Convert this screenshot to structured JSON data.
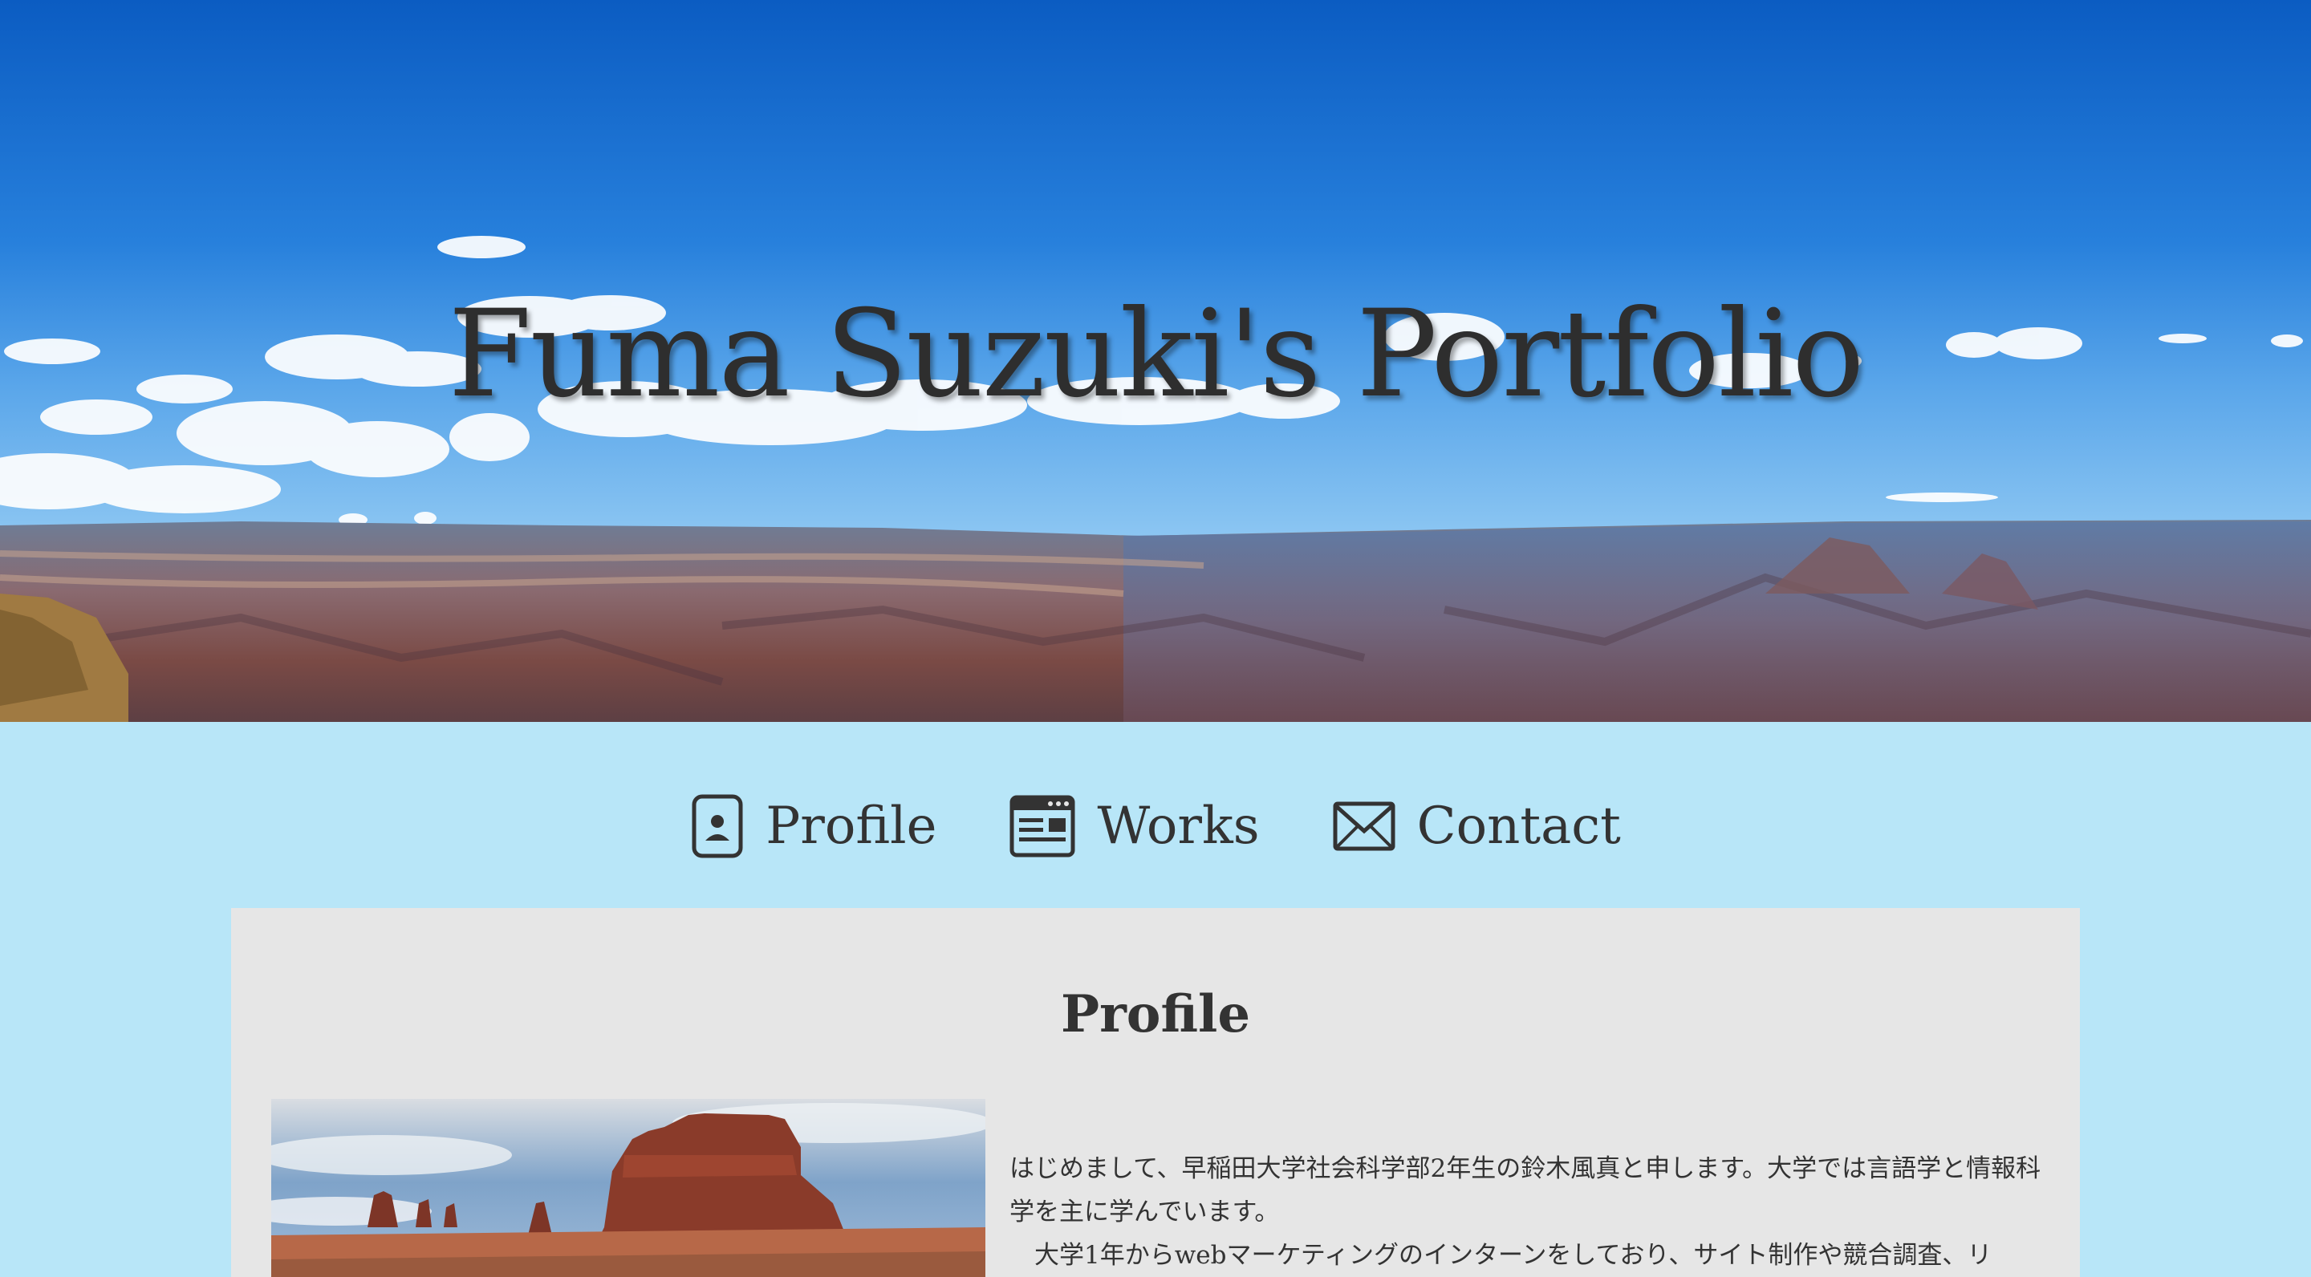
{
  "hero": {
    "title": "Fuma Suzuki's Portfolio"
  },
  "nav": {
    "items": [
      {
        "label": "Profile",
        "icon": "profile-card-icon"
      },
      {
        "label": "Works",
        "icon": "browser-window-icon"
      },
      {
        "label": "Contact",
        "icon": "envelope-icon"
      }
    ]
  },
  "profile": {
    "heading": "Profile",
    "paragraph1": "はじめまして、早稲田大学社会科学部2年生の鈴木風真と申します。大学では言語学と情報科学を主に学んでいます。",
    "paragraph2": "大学1年からwebマーケティングのインターンをしており、サイト制作や競合調査、リ"
  },
  "colors": {
    "page_background": "#b8e6f8",
    "panel_background": "#e6e6e6",
    "text": "#333333"
  }
}
